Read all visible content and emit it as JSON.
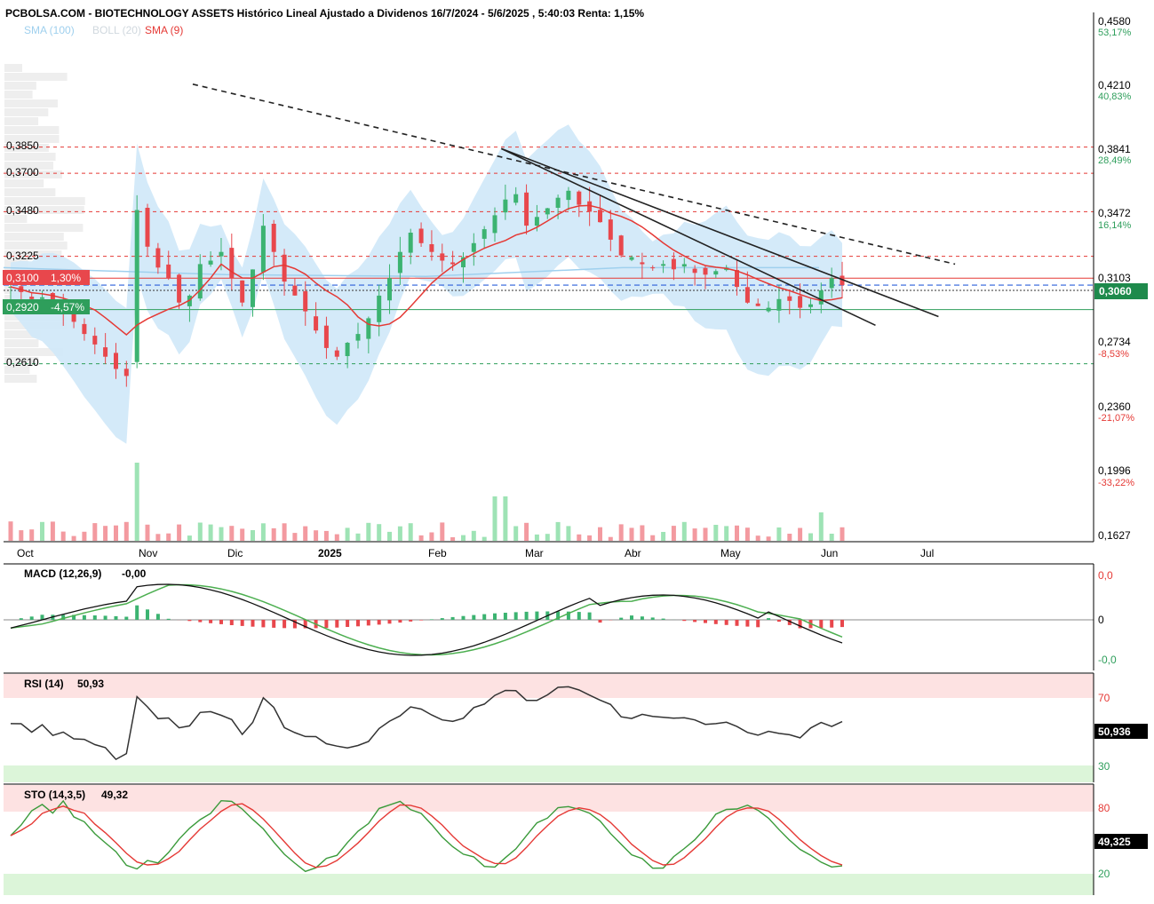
{
  "header": {
    "title": "PCBOLSA.COM - BIOTECHNOLOGY ASSETS Histórico Lineal Ajustado a Dividenos 16/7/2024 - 5/6/2025 , 5:40:03 Renta: 1,15%",
    "legend_sma100": "SMA (100)",
    "legend_boll": "BOLL (20)",
    "legend_sma9": "SMA (9)"
  },
  "colors": {
    "up": "#3cb371",
    "down": "#e8474c",
    "sma9": "#e53935",
    "sma100": "#9fd0ee",
    "boll_fill": "#cfe8f8",
    "trend": "#222222",
    "resistance": "#e53935",
    "support": "#2e9e5b",
    "current": "#2b5fd9",
    "price_badge": "#1e8a4c",
    "macd_line": "#111111",
    "macd_signal": "#4caf50",
    "overbought_band": "#fde2e2",
    "oversold_band": "#dcf5d9"
  },
  "price_axis": {
    "levels": [
      {
        "value": "0,4580",
        "pct": "53,17%",
        "pct_color": "#2e9e5b"
      },
      {
        "value": "0,4210",
        "pct": "40,83%",
        "pct_color": "#2e9e5b"
      },
      {
        "value": "0,3841",
        "pct": "28,49%",
        "pct_color": "#2e9e5b"
      },
      {
        "value": "0,3472",
        "pct": "16,14%",
        "pct_color": "#2e9e5b"
      },
      {
        "value": "0,3103",
        "pct": "",
        "pct_color": "#2e9e5b"
      },
      {
        "value": "0,2734",
        "pct": "-8,53%",
        "pct_color": "#e53935"
      },
      {
        "value": "0,2360",
        "pct": "-21,07%",
        "pct_color": "#e53935"
      },
      {
        "value": "0,1996",
        "pct": "-33,22%",
        "pct_color": "#e53935"
      },
      {
        "value": "0,1627",
        "pct": "",
        "pct_color": "#e53935"
      }
    ],
    "current_price": "0,3060"
  },
  "level_labels": {
    "l3850": "0,3850",
    "l3700": "0,3700",
    "l3480": "0,3480",
    "l3225": "0,3225",
    "l3100": "0,3100",
    "l3100_pct": "1,30%",
    "l2920": "0,2920",
    "l2920_pct": "-4,57%",
    "l2610": "0,2610"
  },
  "months": [
    "Oct",
    "Nov",
    "Dic",
    "2025",
    "Feb",
    "Mar",
    "Abr",
    "May",
    "Jun",
    "Jul"
  ],
  "macd": {
    "label": "MACD (12,26,9)",
    "value": "-0,00",
    "axis_top": "0,0",
    "axis_mid": "0",
    "axis_bottom": "-0,0"
  },
  "rsi": {
    "label": "RSI (14)",
    "value": "50,93",
    "current": "50,936",
    "upper": "70",
    "lower": "30"
  },
  "sto": {
    "label": "STO (14,3,5)",
    "value": "49,32",
    "current": "49,325",
    "upper": "80",
    "lower": "20"
  },
  "chart_data": {
    "type": "candlestick",
    "title": "PCBOLSA.COM - BIOTECHNOLOGY ASSETS Histórico Lineal Ajustado a Dividenos 16/7/2024 - 5/6/2025 , 5:40:03 Renta: 1,15%",
    "x_range": [
      "2024-10",
      "2025-07"
    ],
    "ylim": [
      0.1627,
      0.458
    ],
    "y_ticks": [
      0.458,
      0.421,
      0.3841,
      0.3472,
      0.3103,
      0.2734,
      0.236,
      0.1996,
      0.1627
    ],
    "horizontal_levels": [
      0.385,
      0.37,
      0.348,
      0.3225,
      0.31,
      0.292,
      0.261
    ],
    "current_price": 0.306,
    "trendlines": [
      {
        "from": [
          "2024-11-20",
          0.421
        ],
        "to": [
          "2025-07-12",
          0.318
        ],
        "style": "dashed"
      },
      {
        "from": [
          "2025-02-24",
          0.3841
        ],
        "to": [
          "2025-07-07",
          0.288
        ],
        "style": "solid"
      },
      {
        "from": [
          "2025-02-24",
          0.3841
        ],
        "to": [
          "2025-06-18",
          0.283
        ],
        "style": "solid"
      }
    ],
    "series": [
      {
        "name": "SMA (9)",
        "x": [
          "2024-10",
          "2024-11",
          "2024-12",
          "2025-01",
          "2025-02",
          "2025-03",
          "2025-04",
          "2025-05",
          "2025-06"
        ],
        "values": [
          0.298,
          0.28,
          0.315,
          0.276,
          0.34,
          0.355,
          0.314,
          0.298,
          0.3
        ]
      },
      {
        "name": "SMA (100)",
        "x": [
          "2024-10",
          "2024-12",
          "2025-02",
          "2025-04",
          "2025-06"
        ],
        "values": [
          0.316,
          0.312,
          0.311,
          0.316,
          0.316
        ]
      }
    ],
    "close": [
      0.305,
      0.302,
      0.298,
      0.299,
      0.296,
      0.291,
      0.285,
      0.278,
      0.272,
      0.265,
      0.258,
      0.254,
      0.349,
      0.328,
      0.316,
      0.31,
      0.296,
      0.3,
      0.318,
      0.32,
      0.325,
      0.31,
      0.296,
      0.315,
      0.34,
      0.325,
      0.308,
      0.3,
      0.291,
      0.28,
      0.27,
      0.265,
      0.273,
      0.278,
      0.287,
      0.3,
      0.31,
      0.325,
      0.336,
      0.33,
      0.325,
      0.32,
      0.318,
      0.322,
      0.33,
      0.338,
      0.346,
      0.355,
      0.358,
      0.34,
      0.345,
      0.35,
      0.356,
      0.36,
      0.352,
      0.348,
      0.342,
      0.332,
      0.323,
      0.322,
      0.318,
      0.316,
      0.318,
      0.315,
      0.318,
      0.313,
      0.312,
      0.314,
      0.316,
      0.305,
      0.296,
      0.294,
      0.293,
      0.298,
      0.297,
      0.293,
      0.295,
      0.303,
      0.31,
      0.306
    ]
  }
}
